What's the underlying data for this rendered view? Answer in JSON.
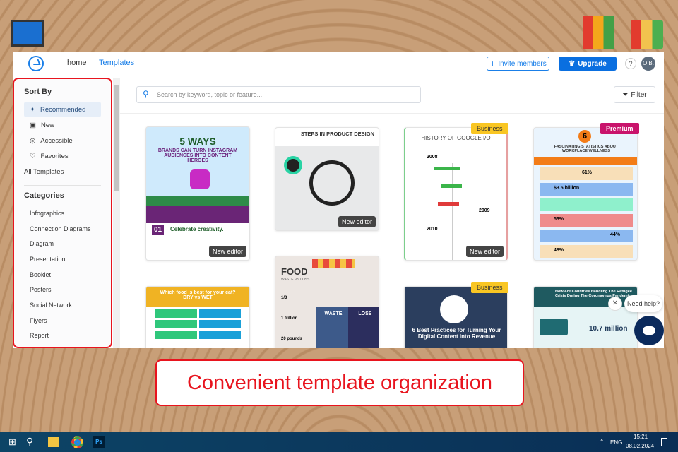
{
  "header": {
    "nav": [
      "home",
      "Templates"
    ],
    "invite": "Invite members",
    "upgrade": "Upgrade",
    "help": "?",
    "avatar": "O.B."
  },
  "sidebar": {
    "sort_title": "Sort By",
    "sort_items": [
      "Recommended",
      "New",
      "Accessible",
      "Favorites",
      "All Templates"
    ],
    "cat_title": "Categories",
    "categories": [
      "Infographics",
      "Connection Diagrams",
      "Diagram",
      "Presentation",
      "Booklet",
      "Posters",
      "Social Network",
      "Flyers",
      "Report"
    ]
  },
  "search": {
    "placeholder": "Search by keyword, topic or feature..."
  },
  "filter": "Filter",
  "cards": [
    {
      "title": "5 WAYS",
      "sub": "BRANDS CAN TURN INSTAGRAM AUDIENCES INTO CONTENT HEROES",
      "extra": "Celebrate creativity.",
      "num": "01",
      "tag": "New editor"
    },
    {
      "title": "STEPS IN PRODUCT DESIGN",
      "tag": "New editor"
    },
    {
      "title": "HISTORY OF GOOGLE I/O",
      "badge": "Business",
      "years": [
        "2008",
        "2009",
        "2010"
      ],
      "tag": "New editor"
    },
    {
      "title": "FASCINATING STATISTICS ABOUT WORKPLACE WELLNESS",
      "badge": "Premium",
      "num": "6",
      "stats": [
        "61%",
        "$3.5 billion",
        "",
        "53%",
        "44%",
        "48%"
      ]
    },
    {
      "title": "Which food is best for your cat?",
      "sub": "DRY vs WET"
    },
    {
      "title": "FOOD",
      "sub": "WASTE VS LOSS",
      "cols": [
        "WASTE",
        "LOSS"
      ],
      "stats": [
        "1/3",
        "1 trillion",
        "20 pounds"
      ]
    },
    {
      "title": "6 Best Practices for Turning Your Digital Content into Revenue",
      "badge": "Business"
    },
    {
      "title": "How Are Countries Handling The Refugee Crisis During The Coronavirus Pandemic",
      "stat": "10.7 million"
    }
  ],
  "help_bubble": "Need help?",
  "caption": "Convenient template organization",
  "taskbar": {
    "lang": "ENG",
    "time": "15:21",
    "date": "08.02.2024",
    "ps": "Ps"
  }
}
